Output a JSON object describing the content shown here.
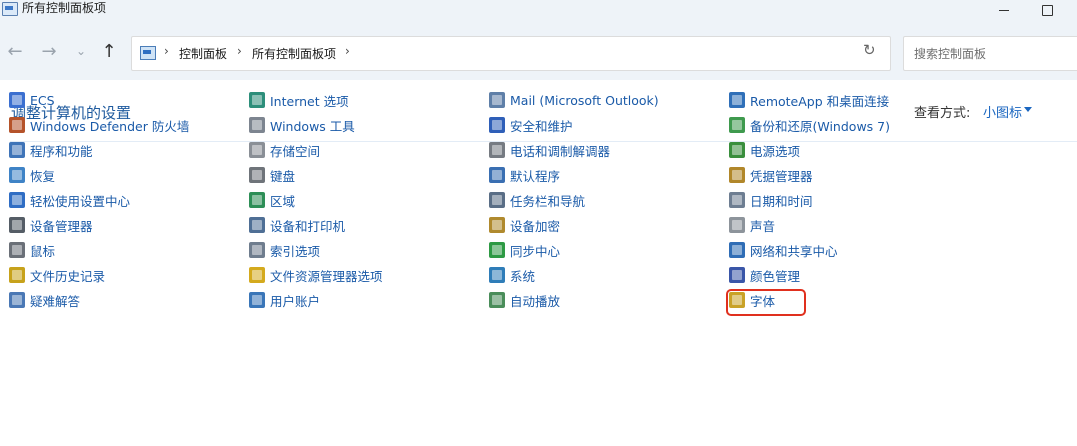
{
  "window": {
    "title": "所有控制面板项"
  },
  "address": {
    "crumbs": [
      "控制面板",
      "所有控制面板项"
    ],
    "separator": "›",
    "dropdown": "⌄",
    "refresh": "↻"
  },
  "search": {
    "placeholder": "搜索控制面板"
  },
  "nav": {
    "back": "←",
    "forward": "→",
    "recent": "⌄",
    "up": "↑"
  },
  "header": {
    "title": "调整计算机的设置",
    "view_by_label": "查看方式:",
    "view_by_value": "小图标"
  },
  "columns": [
    {
      "items": [
        {
          "label": "ECS",
          "icon": "ecs-icon",
          "color": "#3b6fd0"
        },
        {
          "label": "Windows Defender 防火墙",
          "icon": "firewall-icon",
          "color": "#b5532a"
        },
        {
          "label": "程序和功能",
          "icon": "programs-icon",
          "color": "#3f74b8"
        },
        {
          "label": "恢复",
          "icon": "recovery-icon",
          "color": "#3f83c6"
        },
        {
          "label": "轻松使用设置中心",
          "icon": "ease-of-access-icon",
          "color": "#2f6dc4"
        },
        {
          "label": "设备管理器",
          "icon": "device-manager-icon",
          "color": "#555d66"
        },
        {
          "label": "鼠标",
          "icon": "mouse-icon",
          "color": "#6b7078"
        },
        {
          "label": "文件历史记录",
          "icon": "file-history-icon",
          "color": "#c7a21b"
        },
        {
          "label": "疑难解答",
          "icon": "troubleshooting-icon",
          "color": "#4a78b5"
        }
      ]
    },
    {
      "items": [
        {
          "label": "Internet 选项",
          "icon": "internet-options-icon",
          "color": "#2d8f7b"
        },
        {
          "label": "Windows 工具",
          "icon": "windows-tools-icon",
          "color": "#7d8590"
        },
        {
          "label": "存储空间",
          "icon": "storage-spaces-icon",
          "color": "#8a8f96"
        },
        {
          "label": "键盘",
          "icon": "keyboard-icon",
          "color": "#6f747a"
        },
        {
          "label": "区域",
          "icon": "region-icon",
          "color": "#2e8f57"
        },
        {
          "label": "设备和打印机",
          "icon": "devices-printers-icon",
          "color": "#4f6f95"
        },
        {
          "label": "索引选项",
          "icon": "indexing-icon",
          "color": "#6f7d8e"
        },
        {
          "label": "文件资源管理器选项",
          "icon": "explorer-options-icon",
          "color": "#d4aa1e"
        },
        {
          "label": "用户账户",
          "icon": "user-accounts-icon",
          "color": "#3a76b8"
        }
      ]
    },
    {
      "items": [
        {
          "label": "Mail (Microsoft Outlook)",
          "icon": "mail-icon",
          "color": "#5f7fa8"
        },
        {
          "label": "安全和维护",
          "icon": "security-flag-icon",
          "color": "#2f5fb8"
        },
        {
          "label": "电话和调制解调器",
          "icon": "phone-modem-icon",
          "color": "#767b82"
        },
        {
          "label": "默认程序",
          "icon": "default-programs-icon",
          "color": "#3a6fb2"
        },
        {
          "label": "任务栏和导航",
          "icon": "taskbar-icon",
          "color": "#5a6e86"
        },
        {
          "label": "设备加密",
          "icon": "encryption-key-icon",
          "color": "#b08a2e"
        },
        {
          "label": "同步中心",
          "icon": "sync-center-icon",
          "color": "#2e9a44"
        },
        {
          "label": "系统",
          "icon": "system-icon",
          "color": "#2f7db8"
        },
        {
          "label": "自动播放",
          "icon": "autoplay-icon",
          "color": "#4a8d5a"
        }
      ]
    },
    {
      "items": [
        {
          "label": "RemoteApp 和桌面连接",
          "icon": "remoteapp-icon",
          "color": "#2f6fb8"
        },
        {
          "label": "备份和还原(Windows 7)",
          "icon": "backup-restore-icon",
          "color": "#3f9a4e"
        },
        {
          "label": "电源选项",
          "icon": "power-options-icon",
          "color": "#3a8f3d"
        },
        {
          "label": "凭据管理器",
          "icon": "credential-manager-icon",
          "color": "#b1872a"
        },
        {
          "label": "日期和时间",
          "icon": "date-time-icon",
          "color": "#6e7e92"
        },
        {
          "label": "声音",
          "icon": "sound-icon",
          "color": "#8d949b"
        },
        {
          "label": "网络和共享中心",
          "icon": "network-sharing-icon",
          "color": "#2f6db6"
        },
        {
          "label": "颜色管理",
          "icon": "color-management-icon",
          "color": "#3a56a8"
        },
        {
          "label": "字体",
          "icon": "fonts-icon",
          "color": "#c9a227"
        }
      ]
    }
  ]
}
